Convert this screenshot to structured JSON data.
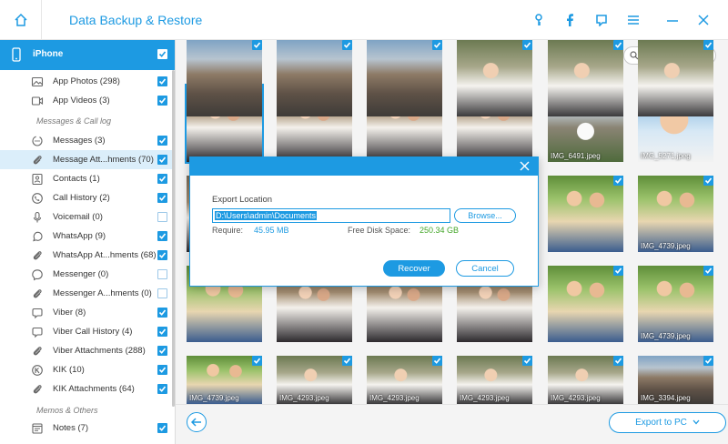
{
  "titlebar": {
    "title": "Data Backup & Restore",
    "icons": [
      "home-icon",
      "key-icon",
      "facebook-icon",
      "feedback-icon",
      "menu-icon",
      "minimize-icon",
      "close-icon"
    ]
  },
  "sidebar": {
    "device": "iPhone",
    "groups": {
      "messages": "Messages & Call log",
      "memos": "Memos & Others"
    },
    "items": [
      {
        "label": "App Photos (298)",
        "icon": "image-icon",
        "checked": true
      },
      {
        "label": "App Videos (3)",
        "icon": "video-icon",
        "checked": true
      },
      {
        "label": "Messages (3)",
        "icon": "message-icon",
        "checked": true
      },
      {
        "label": "Message Att...hments (70)",
        "icon": "attachment-icon",
        "checked": true
      },
      {
        "label": "Contacts (1)",
        "icon": "contact-icon",
        "checked": true
      },
      {
        "label": "Call History (2)",
        "icon": "phone-icon",
        "checked": true
      },
      {
        "label": "Voicemail (0)",
        "icon": "microphone-icon",
        "checked": false
      },
      {
        "label": "WhatsApp (9)",
        "icon": "whatsapp-icon",
        "checked": true
      },
      {
        "label": "WhatsApp At...hments (68)",
        "icon": "attachment-icon",
        "checked": true
      },
      {
        "label": "Messenger (0)",
        "icon": "messenger-icon",
        "checked": false
      },
      {
        "label": "Messenger A...hments (0)",
        "icon": "attachment-icon",
        "checked": false
      },
      {
        "label": "Viber (8)",
        "icon": "viber-icon",
        "checked": true
      },
      {
        "label": "Viber Call History (4)",
        "icon": "viber-icon",
        "checked": true
      },
      {
        "label": "Viber Attachments (288)",
        "icon": "attachment-icon",
        "checked": true
      },
      {
        "label": "KIK (10)",
        "icon": "kik-icon",
        "checked": true
      },
      {
        "label": "KIK Attachments (64)",
        "icon": "attachment-icon",
        "checked": true
      },
      {
        "label": "Notes (7)",
        "icon": "notes-icon",
        "checked": true
      }
    ]
  },
  "main": {
    "search_placeholder": "Search",
    "thumbnails": [
      {
        "caption": "",
        "palette": "wedding"
      },
      {
        "caption": "",
        "palette": "wedding"
      },
      {
        "caption": "",
        "palette": "wedding"
      },
      {
        "caption": "",
        "palette": "wedding"
      },
      {
        "caption": "IMG_6491.jpeg",
        "palette": "church"
      },
      {
        "caption": "IMG_5271.jpeg",
        "palette": "baby"
      },
      {
        "caption": "",
        "palette": "wedding"
      },
      {
        "caption": "",
        "palette": "wedding"
      },
      {
        "caption": "",
        "palette": "wedding"
      },
      {
        "caption": "",
        "palette": "wedding"
      },
      {
        "caption": "",
        "palette": "kids"
      },
      {
        "caption": "IMG_4739.jpeg",
        "palette": "kids"
      },
      {
        "caption": "",
        "palette": "kids"
      },
      {
        "caption": "",
        "palette": "wedding"
      },
      {
        "caption": "",
        "palette": "wedding"
      },
      {
        "caption": "",
        "palette": "wedding"
      },
      {
        "caption": "",
        "palette": "kids"
      },
      {
        "caption": "IMG_4739.jpeg",
        "palette": "kids"
      },
      {
        "caption": "IMG_4739.jpeg",
        "palette": "kids"
      },
      {
        "caption": "IMG_4293.jpeg",
        "palette": "couple"
      },
      {
        "caption": "IMG_4293.jpeg",
        "palette": "couple"
      },
      {
        "caption": "IMG_4293.jpeg",
        "palette": "couple"
      },
      {
        "caption": "IMG_4293.jpeg",
        "palette": "couple"
      },
      {
        "caption": "IMG_3394.jpeg",
        "palette": "city"
      },
      {
        "caption": "",
        "palette": "city"
      },
      {
        "caption": "",
        "palette": "city"
      },
      {
        "caption": "",
        "palette": "city"
      },
      {
        "caption": "",
        "palette": "couple"
      },
      {
        "caption": "",
        "palette": "couple"
      },
      {
        "caption": "",
        "palette": "couple"
      }
    ],
    "export_label": "Export to PC"
  },
  "dialog": {
    "title_label": "Export Location",
    "path": "D:\\Users\\admin\\Documents",
    "browse_label": "Browse...",
    "require_label": "Require:",
    "require_value": "45.95 MB",
    "free_label": "Free Disk Space:",
    "free_value": "250.34 GB",
    "recover_label": "Recover",
    "cancel_label": "Cancel"
  },
  "colors": {
    "accent": "#1d9ae2",
    "green": "#44a629"
  }
}
